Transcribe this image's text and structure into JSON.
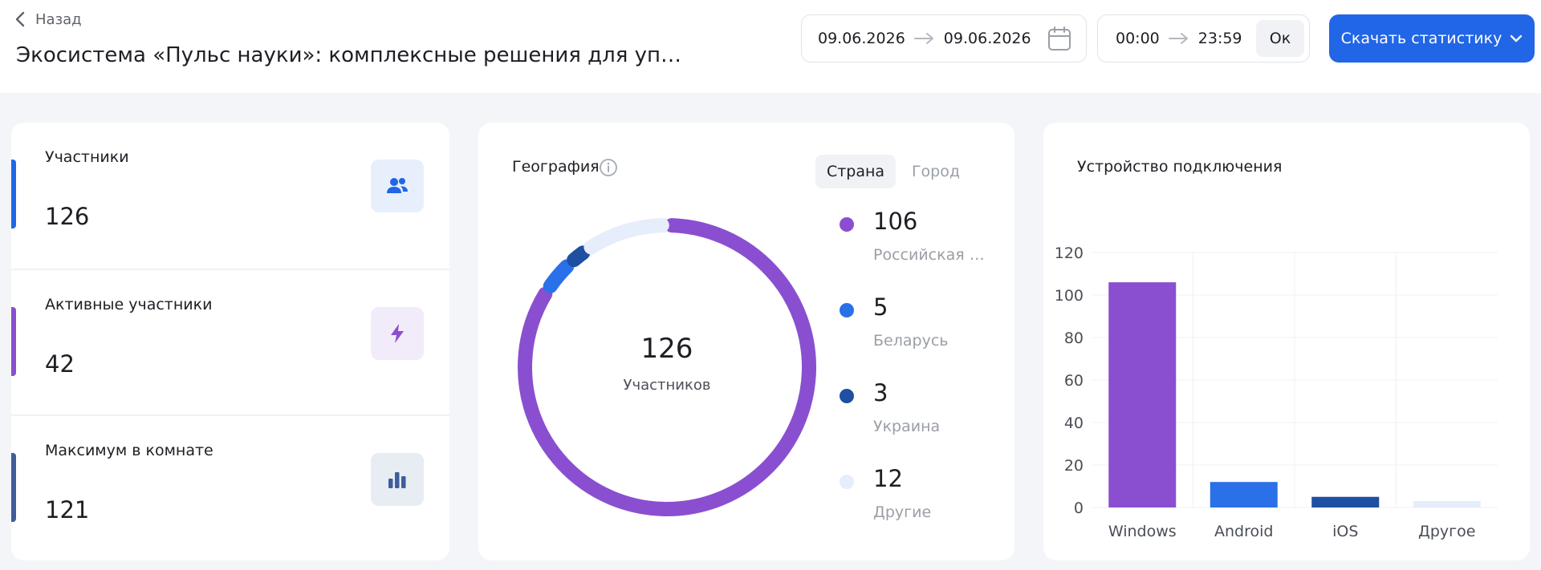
{
  "header": {
    "back_label": "Назад",
    "title": "Экосистема «Пульс науки»: комплексные решения для уп…",
    "date_from": "09.06.2026",
    "date_to": "09.06.2026",
    "time_from": "00:00",
    "time_to": "23:59",
    "ok_label": "Ок",
    "download_label": "Скачать статистику"
  },
  "stats": [
    {
      "label": "Участники",
      "value": "126",
      "accent": "#2166e6",
      "icon": "users-icon"
    },
    {
      "label": "Активные участники",
      "value": "42",
      "accent": "#8a4fd0",
      "icon": "lightning-icon"
    },
    {
      "label": "Максимум в комнате",
      "value": "121",
      "accent": "#3e5d9a",
      "icon": "bar-chart-icon"
    }
  ],
  "geography": {
    "title": "География",
    "tabs": [
      "Страна",
      "Город"
    ],
    "active_tab": "Страна",
    "total": "126",
    "total_label": "Участников",
    "items": [
      {
        "value": 106,
        "name": "Российская …",
        "color": "#8a4fd0"
      },
      {
        "value": 5,
        "name": "Беларусь",
        "color": "#2a70e8"
      },
      {
        "value": 3,
        "name": "Украина",
        "color": "#1e4fa0"
      },
      {
        "value": 12,
        "name": "Другие",
        "color": "#e6edfb"
      }
    ]
  },
  "devices": {
    "title": "Устройство подключения"
  },
  "chart_data": {
    "type": "bar",
    "title": "Устройство подключения",
    "categories": [
      "Windows",
      "Android",
      "iOS",
      "Другое"
    ],
    "values": [
      106,
      12,
      5,
      3
    ],
    "colors": [
      "#8a4fd0",
      "#2a70e8",
      "#1e4fa0",
      "#e6edfb"
    ],
    "ylim": [
      0,
      120
    ],
    "yticks": [
      0,
      20,
      40,
      60,
      80,
      100,
      120
    ],
    "grid": true
  }
}
